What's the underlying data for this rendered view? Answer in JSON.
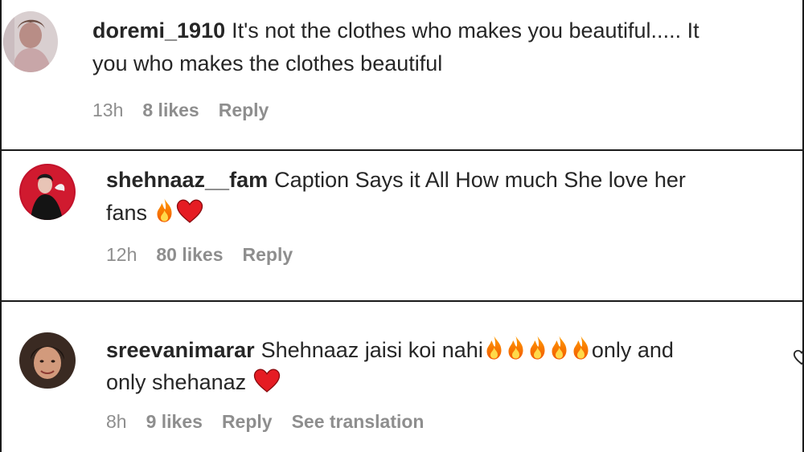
{
  "comments": [
    {
      "username": "doremi_1910",
      "line1": "It's not the clothes who makes you beautiful..... It",
      "line2": "you who makes the clothes beautiful",
      "time": "13h",
      "likes": "8 likes",
      "reply": "Reply"
    },
    {
      "username": "shehnaaz__fam",
      "line1": "Caption Says it All How much She love her",
      "line2": "fans",
      "emojis_line2": [
        "fire-emoji",
        "heart-emoji"
      ],
      "time": "12h",
      "likes": "80 likes",
      "reply": "Reply"
    },
    {
      "username": "sreevanimarar",
      "line1_pre": "Shehnaaz jaisi koi nahi",
      "emojis_line1": [
        "fire-emoji",
        "fire-emoji",
        "fire-emoji",
        "fire-emoji",
        "fire-emoji"
      ],
      "line1_post": "only and",
      "line2": "only shehanaz",
      "emojis_line2": [
        "heart-emoji"
      ],
      "time": "8h",
      "likes": "9 likes",
      "reply": "Reply",
      "translation": "See translation"
    }
  ],
  "icons": {
    "like": "heart-outline-icon"
  },
  "colors": {
    "text": "#262626",
    "meta": "#8e8e8e",
    "border": "#1a1a1a"
  }
}
